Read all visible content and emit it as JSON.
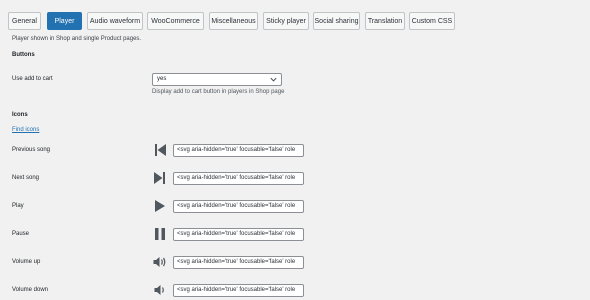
{
  "tabs": [
    "General",
    "Player",
    "Audio waveform",
    "WooCommerce",
    "Miscellaneous",
    "Sticky player",
    "Social sharing",
    "Translation",
    "Custom CSS"
  ],
  "active_tab": "Player",
  "description": "Player shown in Shop and single Product pages.",
  "buttons_section": {
    "heading": "Buttons",
    "add_to_cart": {
      "label": "Use add to cart",
      "value": "yes",
      "hint": "Display add to cart button in players in Shop page"
    }
  },
  "icons_section": {
    "heading": "Icons",
    "find_link": "Find icons",
    "rows": [
      {
        "label": "Previous song",
        "icon": "previous-icon",
        "value": "<svg aria-hidden='true' focusable='false' role"
      },
      {
        "label": "Next song",
        "icon": "next-icon",
        "value": "<svg aria-hidden='true' focusable='false' role"
      },
      {
        "label": "Play",
        "icon": "play-icon",
        "value": "<svg aria-hidden='true' focusable='false' role"
      },
      {
        "label": "Pause",
        "icon": "pause-icon",
        "value": "<svg aria-hidden='true' focusable='false' role"
      },
      {
        "label": "Volume up",
        "icon": "volume-up-icon",
        "value": "<svg aria-hidden='true' focusable='false' role"
      },
      {
        "label": "Volume down",
        "icon": "volume-down-icon",
        "value": "<svg aria-hidden='true' focusable='false' role"
      }
    ]
  },
  "colors": {
    "accent": "#2271b1",
    "icon": "#50575e",
    "background": "#f1f1f1"
  }
}
